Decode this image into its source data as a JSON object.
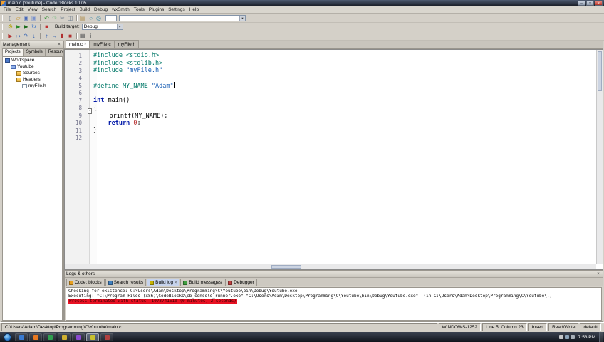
{
  "ui": {
    "close_glyph": "×",
    "dropdown_glyph": "▼",
    "fold_glyph": "-",
    "minimize_glyph": "–",
    "maximize_glyph": "□"
  },
  "colors": {
    "preprocessor": "#007868",
    "keyword": "#0018a8",
    "string": "#1a5fb4",
    "number": "#b22222",
    "error_bg": "#e81123",
    "error_fg": "#3a0000"
  },
  "title_bar": {
    "title": "main.c [Youtube] - Code::Blocks 10.05"
  },
  "menu": {
    "items": [
      "File",
      "Edit",
      "View",
      "Search",
      "Project",
      "Build",
      "Debug",
      "wxSmith",
      "Tools",
      "Plugins",
      "Settings",
      "Help"
    ]
  },
  "toolbars": {
    "input_value": "",
    "combo_value": "",
    "build_target_label": "Build target:",
    "build_target_value": "Debug",
    "row1": [
      {
        "name": "new-file-icon",
        "glyph": "▯",
        "color": "#6a7a8a"
      },
      {
        "name": "open-file-icon",
        "glyph": "▱",
        "color": "#c89020"
      },
      {
        "name": "save-icon",
        "glyph": "▣",
        "color": "#4a6ab8"
      },
      {
        "name": "save-all-icon",
        "glyph": "▣",
        "color": "#7a92cc"
      },
      {
        "name": "undo-icon",
        "glyph": "↶",
        "color": "#2f8f2f"
      },
      {
        "name": "redo-icon",
        "glyph": "↷",
        "color": "#9ec49e"
      },
      {
        "name": "cut-icon",
        "glyph": "✂",
        "color": "#6a7a8a"
      },
      {
        "name": "copy-icon",
        "glyph": "◫",
        "color": "#6a7a8a"
      },
      {
        "name": "paste-icon",
        "glyph": "▤",
        "color": "#b09050"
      },
      {
        "name": "find-icon",
        "glyph": "○",
        "color": "#3a8aa8"
      },
      {
        "name": "replace-icon",
        "glyph": "◎",
        "color": "#3a8aa8"
      }
    ],
    "row2": [
      {
        "name": "build-icon",
        "glyph": "⚙",
        "color": "#b0a000"
      },
      {
        "name": "run-icon",
        "glyph": "▶",
        "color": "#2c8c2c"
      },
      {
        "name": "build-and-run-icon",
        "glyph": "▶",
        "color": "#1c6c1c"
      },
      {
        "name": "rebuild-icon",
        "glyph": "↻",
        "color": "#2c6cc8"
      },
      {
        "name": "abort-build-icon",
        "glyph": "■",
        "color": "#c03030"
      }
    ],
    "row3": [
      {
        "name": "debug-continue-icon",
        "glyph": "▶",
        "color": "#b03030"
      },
      {
        "name": "run-to-cursor-icon",
        "glyph": "↦",
        "color": "#3060b0"
      },
      {
        "name": "next-line-icon",
        "glyph": "↷",
        "color": "#3060b0"
      },
      {
        "name": "step-into-icon",
        "glyph": "↓",
        "color": "#3060b0"
      },
      {
        "name": "step-out-icon",
        "glyph": "↑",
        "color": "#3060b0"
      },
      {
        "name": "next-instruction-icon",
        "glyph": "→",
        "color": "#3060b0"
      },
      {
        "name": "break-debugger-icon",
        "glyph": "▮",
        "color": "#b03030"
      },
      {
        "name": "stop-debugger-icon",
        "glyph": "■",
        "color": "#b03030"
      },
      {
        "name": "debugging-windows-icon",
        "glyph": "▦",
        "color": "#606060"
      },
      {
        "name": "debug-info-icon",
        "glyph": "i",
        "color": "#606060"
      }
    ]
  },
  "management": {
    "title": "Management",
    "tabs": [
      {
        "label": "Projects",
        "active": true
      },
      {
        "label": "Symbols",
        "active": false
      },
      {
        "label": "Resources",
        "active": false
      }
    ],
    "tree": [
      {
        "label": "Workspace",
        "depth": 0,
        "icon": "workspace"
      },
      {
        "label": "Youtube",
        "depth": 1,
        "icon": "project"
      },
      {
        "label": "Sources",
        "depth": 2,
        "icon": "folder"
      },
      {
        "label": "Headers",
        "depth": 2,
        "icon": "folder"
      },
      {
        "label": "myFile.h",
        "depth": 3,
        "icon": "file"
      }
    ]
  },
  "editor": {
    "tabs": [
      {
        "label": "main.c",
        "active": true,
        "closable": true
      },
      {
        "label": "myFile.c",
        "active": false
      },
      {
        "label": "myFile.h",
        "active": false
      }
    ],
    "lines": [
      {
        "n": 1,
        "tokens": [
          {
            "t": "#include <stdio.h>",
            "c": "pp"
          }
        ]
      },
      {
        "n": 2,
        "tokens": [
          {
            "t": "#include <stdlib.h>",
            "c": "pp"
          }
        ]
      },
      {
        "n": 3,
        "tokens": [
          {
            "t": "#include ",
            "c": "pp"
          },
          {
            "t": "\"myFile.h\"",
            "c": "str"
          }
        ]
      },
      {
        "n": 4,
        "tokens": []
      },
      {
        "n": 5,
        "tokens": [
          {
            "t": "#define MY_NAME ",
            "c": "pp"
          },
          {
            "t": "\"Adam\"",
            "c": "str"
          },
          {
            "t": "",
            "c": "caret"
          }
        ]
      },
      {
        "n": 6,
        "tokens": []
      },
      {
        "n": 7,
        "tokens": [
          {
            "t": "int",
            "c": "kw"
          },
          {
            "t": " main()",
            "c": "pl"
          }
        ]
      },
      {
        "n": 8,
        "fold": true,
        "tokens": [
          {
            "t": "{",
            "c": "pl"
          }
        ]
      },
      {
        "n": 9,
        "tokens": [
          {
            "t": "    ",
            "c": "pl"
          },
          {
            "t": "",
            "c": "ibeam"
          },
          {
            "t": "printf(MY_NAME);",
            "c": "pl"
          }
        ]
      },
      {
        "n": 10,
        "tokens": [
          {
            "t": "    ",
            "c": "pl"
          },
          {
            "t": "return",
            "c": "kw"
          },
          {
            "t": " ",
            "c": "pl"
          },
          {
            "t": "0",
            "c": "num"
          },
          {
            "t": ";",
            "c": "pl"
          }
        ]
      },
      {
        "n": 11,
        "tokens": [
          {
            "t": "}",
            "c": "pl"
          }
        ]
      },
      {
        "n": 12,
        "tokens": []
      }
    ]
  },
  "logs": {
    "title": "Logs & others",
    "tabs": [
      {
        "label": "Code::blocks",
        "icon_color": "#e8a020",
        "active": false
      },
      {
        "label": "Search results",
        "icon_color": "#4080c0",
        "active": false
      },
      {
        "label": "Build log",
        "icon_color": "#c8b400",
        "active": true,
        "closable": true
      },
      {
        "label": "Build messages",
        "icon_color": "#40a040",
        "active": false
      },
      {
        "label": "Debugger",
        "icon_color": "#c04040",
        "active": false
      }
    ],
    "lines": [
      {
        "type": "normal",
        "text": "Checking for existence: C:\\Users\\Adam\\Desktop\\Programming\\C\\Youtube\\bin\\Debug\\Youtube.exe"
      },
      {
        "type": "normal",
        "text": "Executing: \"C:\\Program Files (x86)\\CodeBlocks\\cb_console_runner.exe\" \"C:\\Users\\Adam\\Desktop\\Programming\\C\\Youtube\\bin\\Debug\\Youtube.exe\"  (in C:\\Users\\Adam\\Desktop\\Programming\\C\\Youtube\\.)"
      },
      {
        "type": "error",
        "text": "Process terminated with status -1073741510 (0 minutes, 2 seconds)"
      }
    ]
  },
  "statusbar": {
    "segments": [
      "C:\\Users\\Adam\\Desktop\\Programming\\C\\Youtube\\main.c",
      "WINDOWS-1252",
      "Line 5, Column 23",
      "Insert",
      "Read/Write",
      "default"
    ]
  },
  "taskbar": {
    "time": "7:53 PM",
    "apps": [
      {
        "name": "taskbar-app-1",
        "color": "#3a7ad0",
        "active": false
      },
      {
        "name": "taskbar-app-2",
        "color": "#e87820",
        "active": false
      },
      {
        "name": "taskbar-app-3",
        "color": "#30a050",
        "active": false
      },
      {
        "name": "taskbar-app-4",
        "color": "#d0b030",
        "active": false
      },
      {
        "name": "taskbar-app-5",
        "color": "#8a4ad0",
        "active": false
      },
      {
        "name": "taskbar-app-codeblocks",
        "color": "#c8c030",
        "active": true
      },
      {
        "name": "taskbar-app-7",
        "color": "#b04040",
        "active": false
      }
    ],
    "tray_icons": [
      {
        "name": "tray-icon-1",
        "color": "#c0c8d0"
      },
      {
        "name": "tray-icon-2",
        "color": "#9fb8d0"
      },
      {
        "name": "tray-icon-3",
        "color": "#e0e0e0"
      }
    ]
  }
}
